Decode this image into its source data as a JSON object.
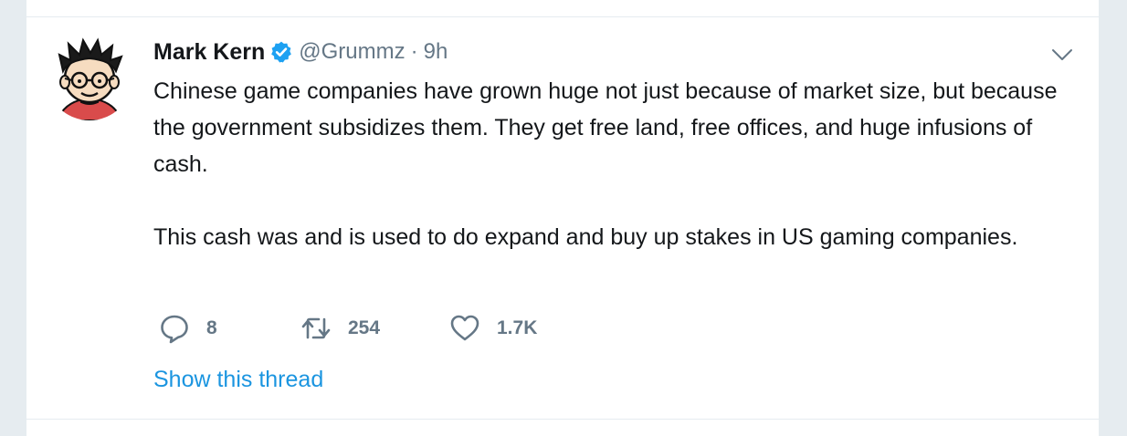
{
  "tweet": {
    "author": {
      "name": "Mark Kern",
      "handle": "@Grummz",
      "verified": true,
      "avatar_icon": "cartoon-avatar-icon"
    },
    "separator": "·",
    "time": "9h",
    "text": {
      "paragraph1": "Chinese game companies have grown huge not just because of market size, but because the government subsidizes them. They get free land, free offices, and huge infusions of cash.",
      "paragraph2": "This cash was and is used to do expand and buy up stakes in US gaming companies."
    },
    "actions": {
      "replies": "8",
      "retweets": "254",
      "likes": "1.7K"
    },
    "show_thread_label": "Show this thread"
  },
  "colors": {
    "background": "#e6ecf0",
    "card": "#ffffff",
    "text_primary": "#14171a",
    "text_secondary": "#657786",
    "link": "#1b95e0",
    "verified_badge": "#1da1f2"
  },
  "icons": {
    "verified": "verified-badge-icon",
    "caret": "chevron-down-icon",
    "reply": "reply-icon",
    "retweet": "retweet-icon",
    "like": "heart-icon"
  }
}
